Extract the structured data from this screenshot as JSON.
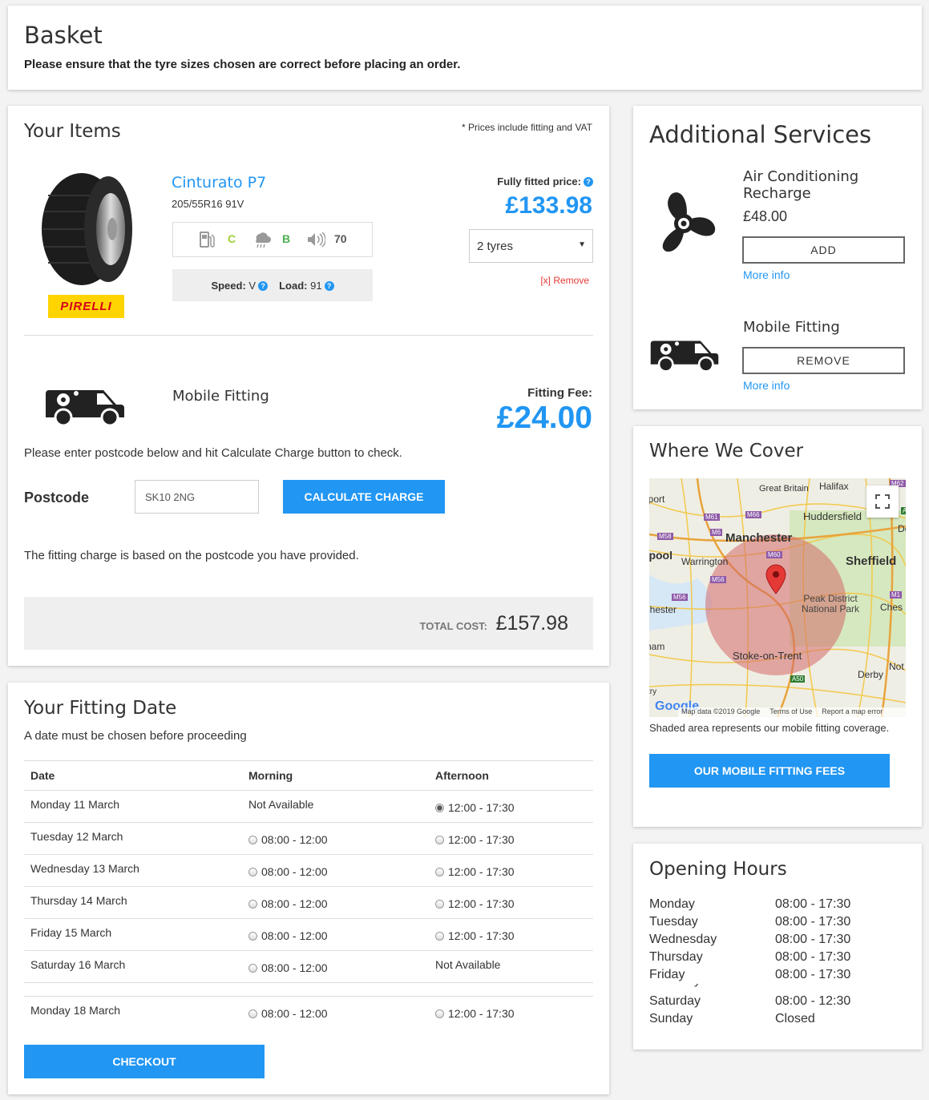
{
  "basket": {
    "title": "Basket",
    "subtitle": "Please ensure that the tyre sizes chosen are correct before placing an order."
  },
  "items": {
    "title": "Your Items",
    "price_note": "* Prices include fitting and VAT",
    "product": {
      "name": "Cinturato P7",
      "size": "205/55R16 91V",
      "brand": "PIRELLI",
      "fuel_rating": "C",
      "wet_rating": "B",
      "noise_db": "70",
      "speed_label": "Speed:",
      "speed_value": "V",
      "load_label": "Load:",
      "load_value": "91",
      "price_label": "Fully fitted price:",
      "price": "£133.98",
      "quantity_selected": "2 tyres",
      "remove_label": "[x] Remove"
    },
    "mobile_fitting": {
      "label": "Mobile Fitting",
      "fee_label": "Fitting Fee:",
      "fee": "£24.00",
      "instruction": "Please enter postcode below and hit Calculate Charge button to check.",
      "postcode_label": "Postcode",
      "postcode_value": "SK10 2NG",
      "calculate_label": "CALCULATE CHARGE",
      "note": "The fitting charge is based on the postcode you have provided."
    },
    "total_label": "TOTAL COST:",
    "total_value": "£157.98"
  },
  "fitting_date": {
    "title": "Your Fitting Date",
    "subtitle": "A date must be chosen before proceeding",
    "headers": [
      "Date",
      "Morning",
      "Afternoon"
    ],
    "rows": [
      {
        "date": "Monday 11 March",
        "morning": "Not Available",
        "afternoon": "12:00 - 17:30"
      },
      {
        "date": "Tuesday 12 March",
        "morning": "08:00 - 12:00",
        "afternoon": "12:00 - 17:30"
      },
      {
        "date": "Wednesday 13 March",
        "morning": "08:00 - 12:00",
        "afternoon": "12:00 - 17:30"
      },
      {
        "date": "Thursday 14 March",
        "morning": "08:00 - 12:00",
        "afternoon": "12:00 - 17:30"
      },
      {
        "date": "Friday 15 March",
        "morning": "08:00 - 12:00",
        "afternoon": "12:00 - 17:30"
      },
      {
        "date": "Saturday 16 March",
        "morning": "08:00 - 12:00",
        "afternoon": "Not Available"
      },
      {
        "date": "Monday 18 March",
        "morning": "08:00 - 12:00",
        "afternoon": "12:00 - 17:30"
      }
    ],
    "checkout_label": "CHECKOUT"
  },
  "additional_services": {
    "title": "Additional Services",
    "aircon": {
      "name": "Air Conditioning Recharge",
      "price": "£48.00",
      "button": "ADD",
      "more_info": "More info"
    },
    "mobile": {
      "name": "Mobile Fitting",
      "button": "REMOVE",
      "more_info": "More info"
    }
  },
  "coverage": {
    "title": "Where We Cover",
    "map_labels": {
      "manchester": "Manchester",
      "sheffield": "Sheffield",
      "huddersfield": "Huddersfield",
      "warrington": "Warrington",
      "stoke": "Stoke-on-Trent",
      "peak": "Peak District National Park",
      "derby": "Derby",
      "chester": "Chester",
      "great_britain": "Great Britain",
      "halifax": "Halifax",
      "pool": "rpool",
      "port": "iport",
      "ches": "Ches",
      "nott": "Not",
      "ham": "ham",
      "try": "try",
      "de": "Dc",
      "m61": "M61",
      "m66": "M66",
      "m62": "M62",
      "m6": "M6",
      "m58": "M58",
      "m60": "M60",
      "m56a": "M56",
      "m56b": "M56",
      "m1": "M1",
      "a50": "A50",
      "a_right": "A"
    },
    "map_credits": [
      "Map data ©2019 Google",
      "Terms of Use",
      "Report a map error"
    ],
    "google": "Google",
    "caption": "Shaded area represents our mobile fitting coverage.",
    "fees_button": "OUR MOBILE FITTING FEES"
  },
  "opening_hours": {
    "title": "Opening Hours",
    "days": [
      {
        "day": "Monday",
        "hours": "08:00 - 17:30"
      },
      {
        "day": "Tuesday",
        "hours": "08:00 - 17:30"
      },
      {
        "day": "Wednesday",
        "hours": "08:00 - 17:30"
      },
      {
        "day": "Thursday",
        "hours": "08:00 - 17:30"
      },
      {
        "day": "Friday",
        "hours": "08:00 - 17:30"
      }
    ],
    "days_after": [
      {
        "day": "Saturday",
        "hours": "08:00 - 12:30"
      },
      {
        "day": "Sunday",
        "hours": "Closed"
      }
    ]
  }
}
